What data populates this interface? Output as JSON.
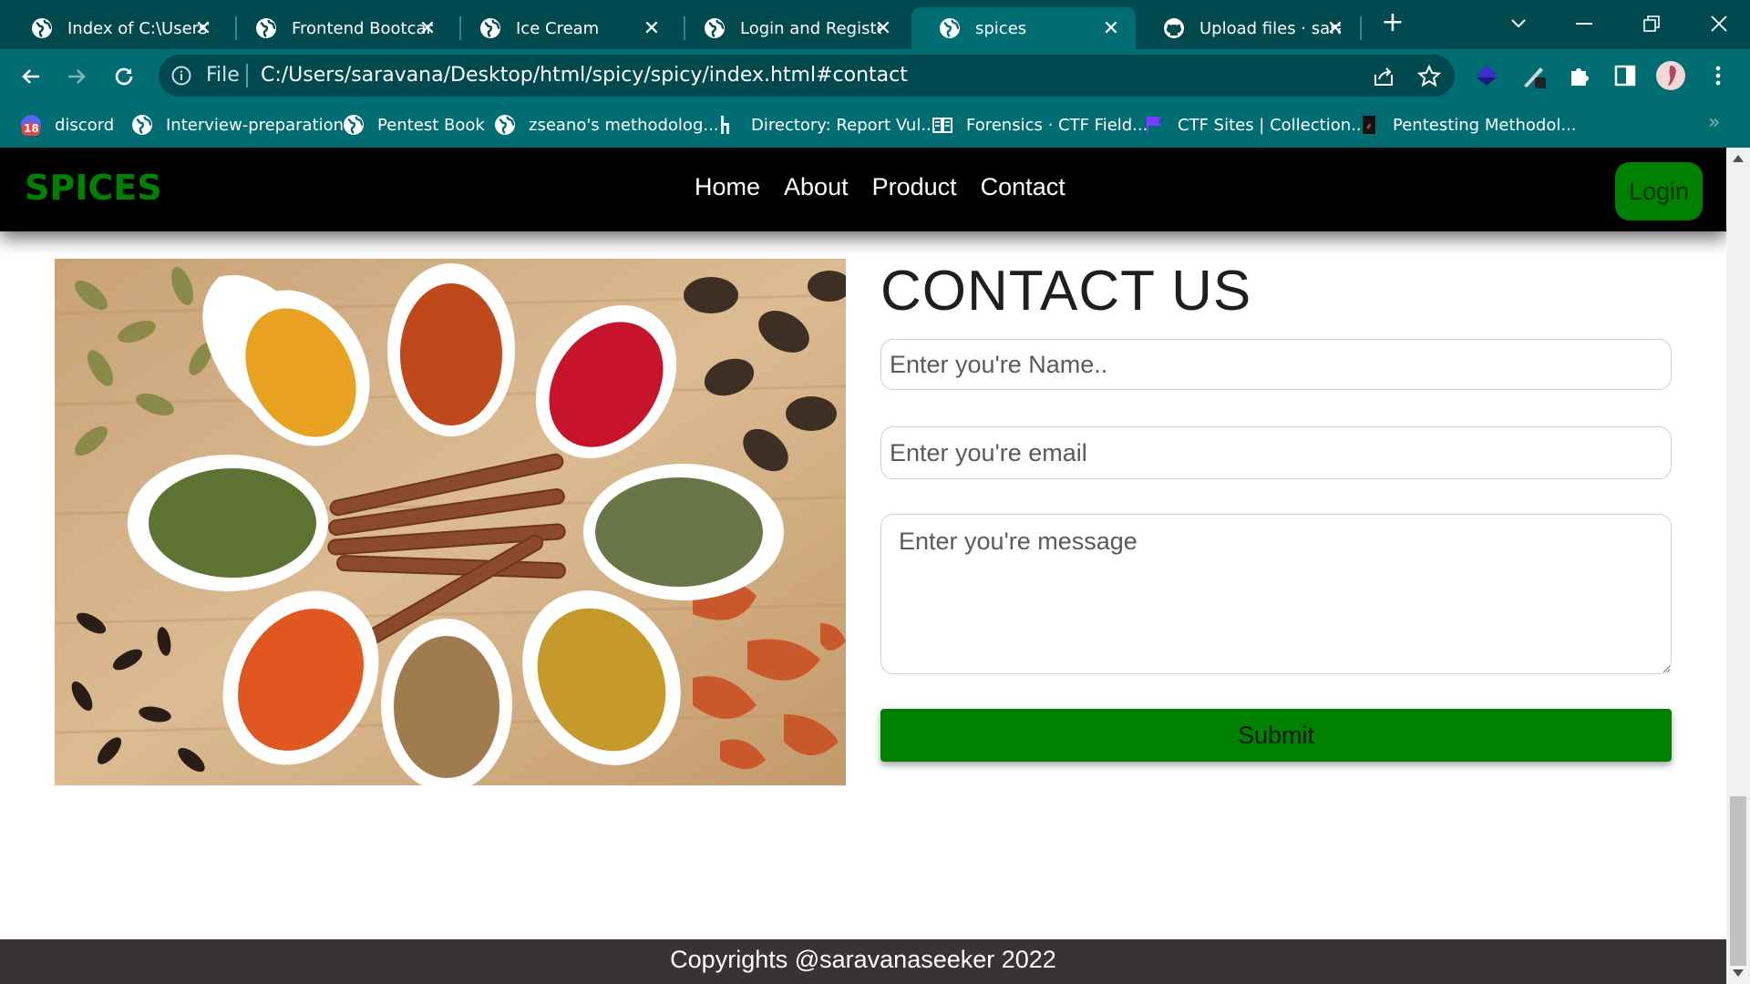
{
  "browser": {
    "tabs": [
      {
        "title": "Index of C:\\Users\\s",
        "icon": "globe-icon",
        "active": false
      },
      {
        "title": "Frontend Bootcam",
        "icon": "globe-icon",
        "active": false
      },
      {
        "title": "Ice Cream",
        "icon": "globe-icon",
        "active": false
      },
      {
        "title": "Login and Register",
        "icon": "globe-icon",
        "active": false
      },
      {
        "title": "spices",
        "icon": "globe-icon",
        "active": true
      },
      {
        "title": "Upload files · sarav",
        "icon": "github-icon",
        "active": false
      }
    ],
    "address": {
      "scheme_label": "File",
      "url": "C:/Users/saravana/Desktop/html/spicy/spicy/index.html#contact"
    },
    "bookmarks": [
      {
        "label": "discord",
        "icon": "discord-icon",
        "badge": "18"
      },
      {
        "label": "Interview-preparation",
        "icon": "globe-icon"
      },
      {
        "label": "Pentest Book",
        "icon": "globe-icon"
      },
      {
        "label": "zseano's methodolog...",
        "icon": "globe-icon"
      },
      {
        "label": "Directory: Report Vul...",
        "icon": "hackerone-icon"
      },
      {
        "label": "Forensics · CTF Field...",
        "icon": "book-icon"
      },
      {
        "label": "CTF Sites | Collection...",
        "icon": "flag-icon"
      },
      {
        "label": "Pentesting Methodol...",
        "icon": "doc-icon"
      }
    ],
    "colors": {
      "frame": "#00494f",
      "toolbar": "#006d73"
    }
  },
  "site": {
    "brand": "SPICES",
    "nav": [
      "Home",
      "About",
      "Product",
      "Contact"
    ],
    "login_label": "Login",
    "accent": "#008000"
  },
  "contact": {
    "title": "CONTACT US",
    "name_placeholder": "Enter you're Name..",
    "email_placeholder": "Enter you're email",
    "message_placeholder": "Enter you're message",
    "submit_label": "Submit"
  },
  "footer": {
    "text": "Copyrights @saravanaseeker 2022",
    "bg": "#3a3335"
  }
}
